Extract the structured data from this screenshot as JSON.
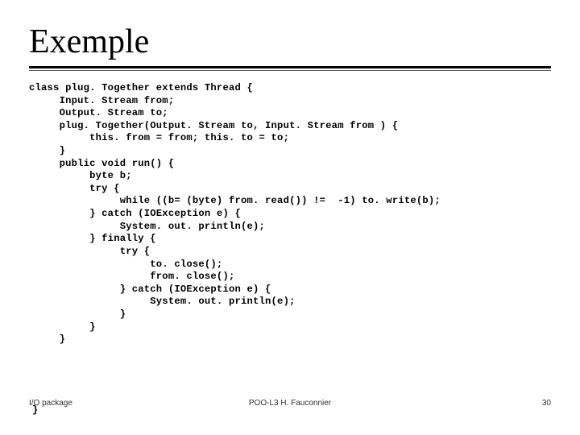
{
  "title": "Exemple",
  "code": "class plug. Together extends Thread {\n     Input. Stream from;\n     Output. Stream to;\n     plug. Together(Output. Stream to, Input. Stream from ) {\n          this. from = from; this. to = to;\n     }\n     public void run() {\n          byte b;\n          try {\n               while ((b= (byte) from. read()) !=  -1) to. write(b);\n          } catch (IOException e) {\n               System. out. println(e);\n          } finally {\n               try {\n                    to. close();\n                    from. close();\n               } catch (IOException e) {\n                    System. out. println(e);\n               }\n          }\n     }",
  "trailing_brace": "}",
  "footer": {
    "left": "I/O package",
    "center": "POO-L3 H. Fauconnier",
    "right": "30"
  }
}
